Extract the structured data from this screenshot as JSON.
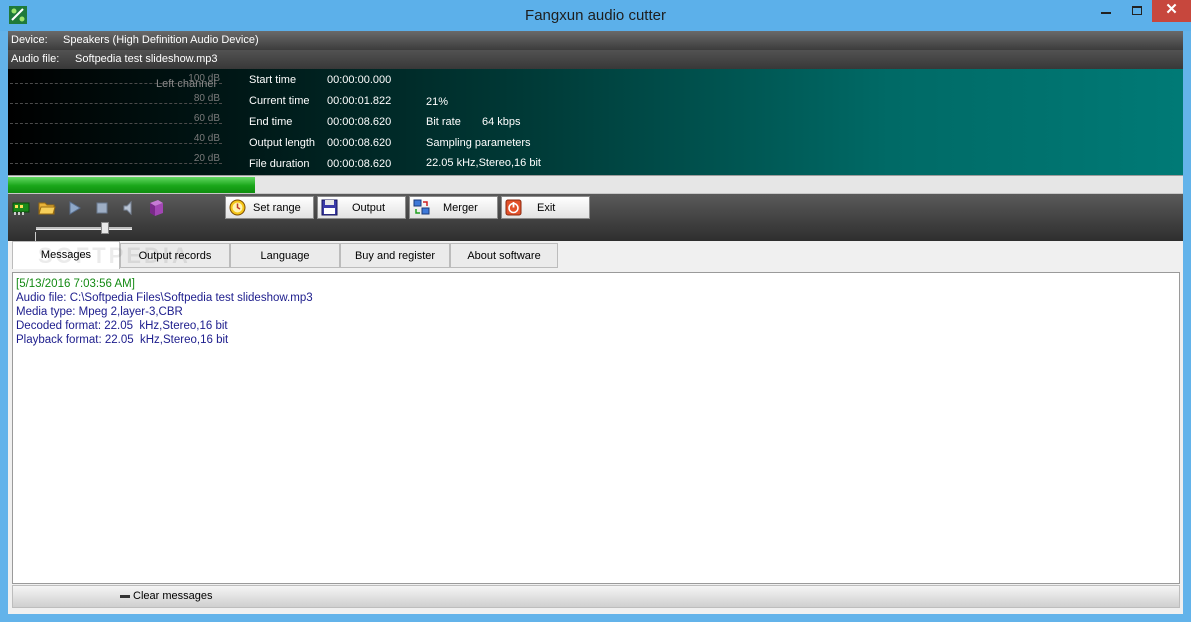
{
  "window": {
    "title": "Fangxun audio cutter",
    "close_glyph": "✕"
  },
  "device": {
    "label": "Device:",
    "value": "Speakers (High Definition Audio Device)"
  },
  "audio_file": {
    "label": "Audio file:",
    "value": "Softpedia test slideshow.mp3"
  },
  "meter": {
    "channel_label": "Left channel",
    "db_levels": [
      "100 dB",
      "80 dB",
      "60 dB",
      "40 dB",
      "20 dB"
    ]
  },
  "display": {
    "start_time_label": "Start time",
    "start_time": "00:00:00.000",
    "current_time_label": "Current time",
    "current_time": "00:00:01.822",
    "end_time_label": "End time",
    "end_time": "00:00:08.620",
    "output_length_label": "Output length",
    "output_length": "00:00:08.620",
    "file_duration_label": "File duration",
    "file_duration": "00:00:08.620",
    "percent": "21%",
    "bitrate_label": "Bit rate",
    "bitrate": "64 kbps",
    "sampling_label": "Sampling parameters",
    "sampling": "22.05  kHz,Stereo,16 bit"
  },
  "progress": {
    "fraction": 0.21
  },
  "volume": {
    "fraction": 0.72
  },
  "toolbar": {
    "set_range": "Set range",
    "output": "Output",
    "merger": "Merger",
    "exit": "Exit"
  },
  "tabs": [
    "Messages",
    "Output records",
    "Language",
    "Buy and register",
    "About software"
  ],
  "watermark": "SOFTPEDIA",
  "messages": [
    "[5/13/2016 7:03:56 AM]",
    "Audio file: C:\\Softpedia Files\\Softpedia test slideshow.mp3",
    "Media type: Mpeg 2,layer-3,CBR",
    "Decoded format: 22.05  kHz,Stereo,16 bit",
    "Playback format: 22.05  kHz,Stereo,16 bit"
  ],
  "clear_messages": "Clear messages",
  "colors": {
    "accent_green": "#1aa61a",
    "display_teal": "#007a76",
    "titlebar": "#5cb0ea"
  }
}
